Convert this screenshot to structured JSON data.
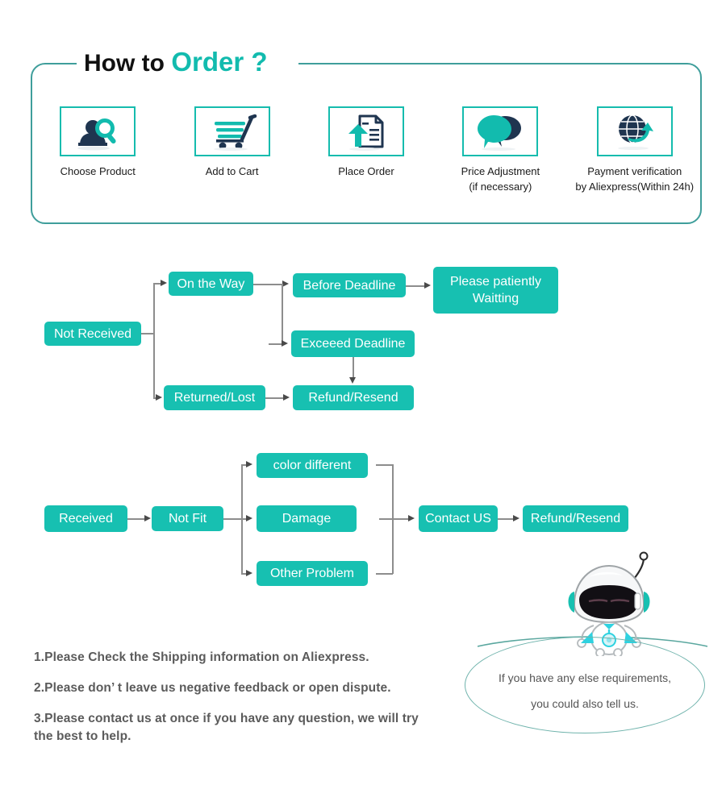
{
  "header": {
    "title_black": "How to ",
    "title_teal": "Order ?"
  },
  "colors": {
    "teal": "#17C0B1",
    "teal_border": "#15BCAE",
    "card_border": "#3f9e9b",
    "navy": "#1f3550",
    "line_gray": "#8d8d8d",
    "note_text": "#5b5b5b"
  },
  "steps": [
    {
      "icon": "person-search-icon",
      "label": "Choose  Product"
    },
    {
      "icon": "shopping-cart-icon",
      "label": "Add to Cart"
    },
    {
      "icon": "document-upload-icon",
      "label": "Place  Order"
    },
    {
      "icon": "speech-bubbles-icon",
      "label": "Price Adjustment\n(if necessary)"
    },
    {
      "icon": "globe-arrow-icon",
      "label": "Payment verification\nby Aliexpress(Within 24h)"
    }
  ],
  "flow_not_received": {
    "nodes": {
      "not_received": "Not Received",
      "on_the_way": "On the Way",
      "before_deadline": "Before Deadline",
      "please_waiting": "Please patiently\nWaitting",
      "exceed_deadline": "Exceeed Deadline",
      "returned_lost": "Returned/Lost",
      "refund_resend": "Refund/Resend"
    }
  },
  "flow_received": {
    "nodes": {
      "received": "Received",
      "not_fit": "Not Fit",
      "color_different": "color different",
      "damage": "Damage",
      "other_problem": "Other Problem",
      "contact_us": "Contact US",
      "refund_resend": "Refund/Resend"
    }
  },
  "notes": [
    "1.Please Check the Shipping information on Aliexpress.",
    "2.Please don’  t leave us negative feedback or open dispute.",
    "3.Please contact us at once if you have any question, we will try",
    " the best to help."
  ],
  "speech": {
    "line1": "If you have any else requirements,",
    "line2": "you could also tell us."
  }
}
